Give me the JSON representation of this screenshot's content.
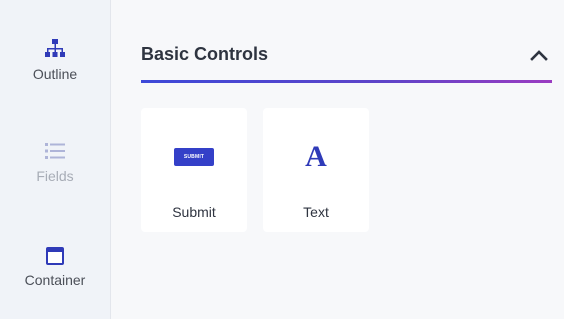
{
  "sidebar": {
    "items": [
      {
        "label": "Outline",
        "icon": "outline-tree-icon",
        "state": "active"
      },
      {
        "label": "Fields",
        "icon": "list-icon",
        "state": "disabled"
      },
      {
        "label": "Container",
        "icon": "container-icon",
        "state": "active"
      }
    ]
  },
  "panel": {
    "title": "Basic Controls",
    "collapse_icon": "chevron-up-icon",
    "cards": [
      {
        "label": "Submit",
        "preview_text": "SUBMIT",
        "icon": "submit-button-icon"
      },
      {
        "label": "Text",
        "preview_text": "A",
        "icon": "text-icon"
      }
    ]
  },
  "colors": {
    "accent": "#3440c8",
    "gradient_start": "#3d49d8",
    "gradient_end": "#9a3cc1",
    "sidebar_bg": "#f0f3f8"
  }
}
